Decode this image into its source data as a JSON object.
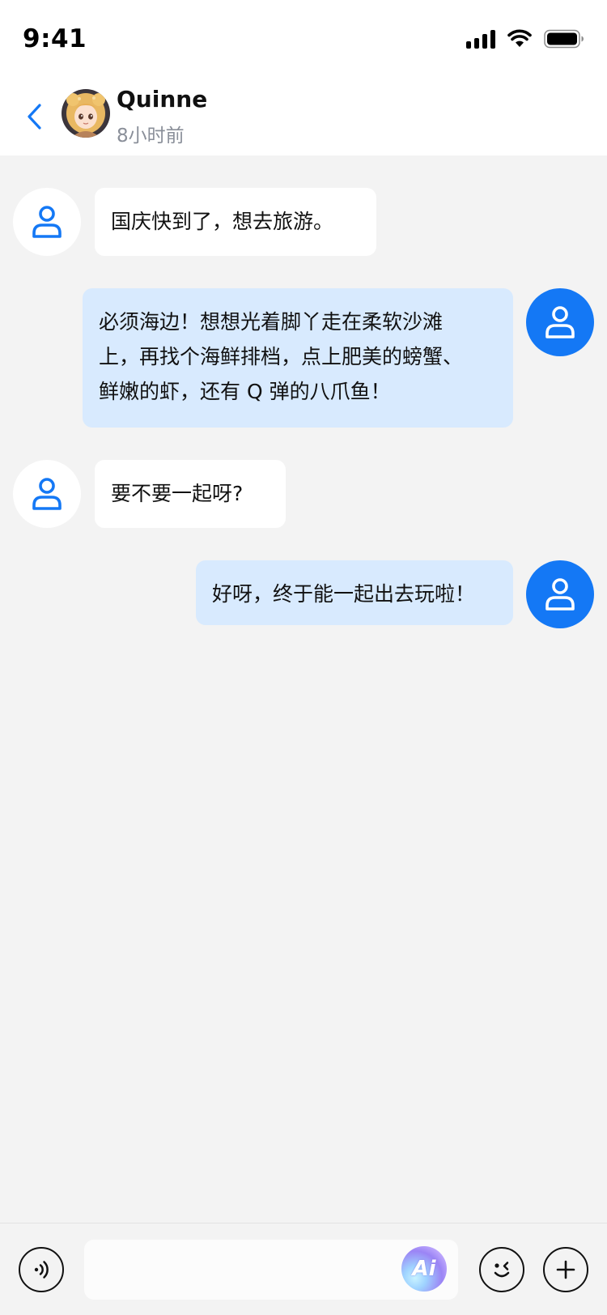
{
  "status_bar": {
    "time": "9:41",
    "icons": [
      "signal-icon",
      "wifi-icon",
      "battery-icon"
    ]
  },
  "header": {
    "back_icon": "chevron-left-icon",
    "contact_name": "Quinne",
    "last_seen": "8小时前"
  },
  "messages": [
    {
      "sender": "contact",
      "text": "国庆快到了，想去旅游。"
    },
    {
      "sender": "self",
      "lines": [
        "必须海边！想想光着脚丫走在柔软沙滩",
        "上，再找个海鲜排档，点上肥美的螃蟹、",
        "鲜嫩的虾，还有 Q 弹的八爪鱼！"
      ]
    },
    {
      "sender": "contact",
      "text": "要不要一起呀?"
    },
    {
      "sender": "self",
      "text": "好呀，终于能一起出去玩啦！"
    }
  ],
  "input_bar": {
    "message_value": "",
    "ai_label": "Ai",
    "icons": [
      "voice-icon",
      "ai-icon",
      "emoji-icon",
      "plus-icon"
    ]
  },
  "colors": {
    "accent": "#1478F5",
    "outgoing_bubble": "#D8EAFE",
    "incoming_bubble": "#FFFFFF",
    "background": "#F3F3F3"
  }
}
